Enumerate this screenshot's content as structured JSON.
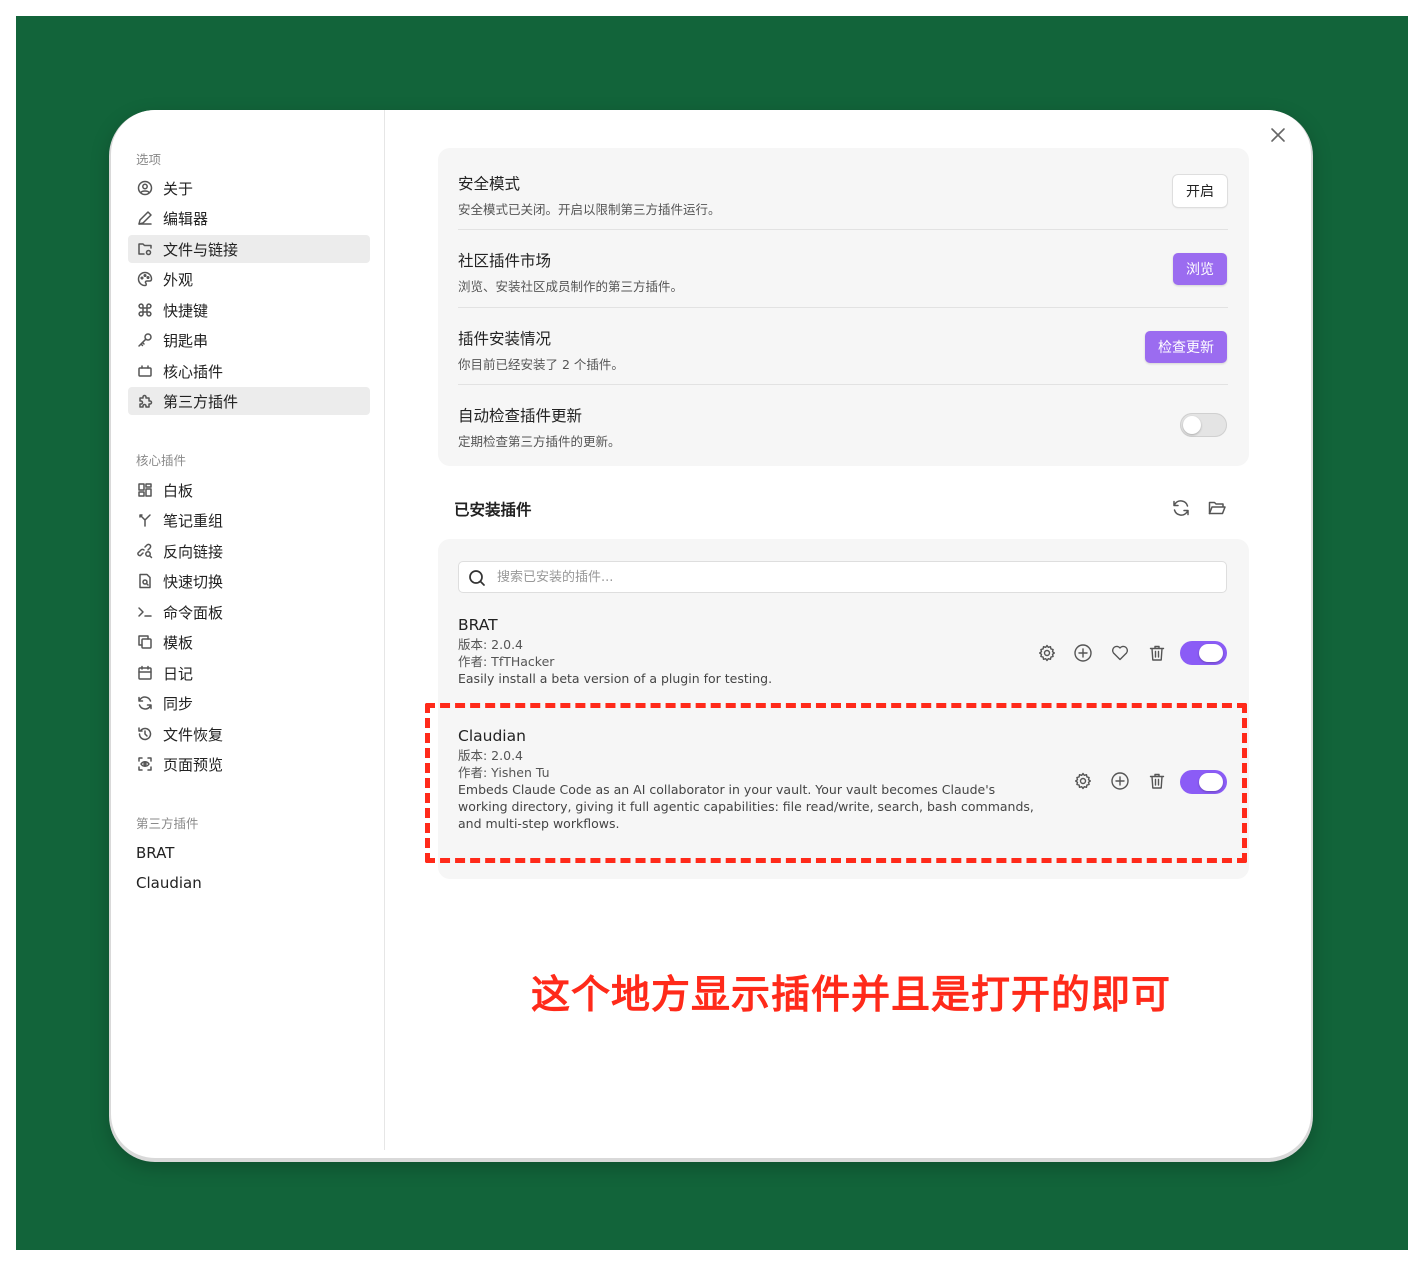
{
  "sidebar": {
    "options_title": "选项",
    "options": [
      {
        "label": "关于",
        "icon": "user-circle-icon"
      },
      {
        "label": "编辑器",
        "icon": "pencil-icon"
      },
      {
        "label": "文件与链接",
        "icon": "folder-cog-icon"
      },
      {
        "label": "外观",
        "icon": "palette-icon"
      },
      {
        "label": "快捷键",
        "icon": "command-icon"
      },
      {
        "label": "钥匙串",
        "icon": "key-icon"
      },
      {
        "label": "核心插件",
        "icon": "plug-icon"
      },
      {
        "label": "第三方插件",
        "icon": "puzzle-icon"
      }
    ],
    "core_title": "核心插件",
    "core": [
      {
        "label": "白板",
        "icon": "layout-dashboard-icon"
      },
      {
        "label": "笔记重组",
        "icon": "merge-icon"
      },
      {
        "label": "反向链接",
        "icon": "link-search-icon"
      },
      {
        "label": "快速切换",
        "icon": "file-search-icon"
      },
      {
        "label": "命令面板",
        "icon": "terminal-icon"
      },
      {
        "label": "模板",
        "icon": "copy-icon"
      },
      {
        "label": "日记",
        "icon": "calendar-icon"
      },
      {
        "label": "同步",
        "icon": "refresh-icon"
      },
      {
        "label": "文件恢复",
        "icon": "history-icon"
      },
      {
        "label": "页面预览",
        "icon": "scan-eye-icon"
      }
    ],
    "third_title": "第三方插件",
    "third": [
      "BRAT",
      "Claudian"
    ]
  },
  "settings": {
    "safe_mode": {
      "title": "安全模式",
      "desc": "安全模式已关闭。开启以限制第三方插件运行。",
      "button": "开启"
    },
    "community": {
      "title": "社区插件市场",
      "desc": "浏览、安装社区成员制作的第三方插件。",
      "button": "浏览"
    },
    "installs": {
      "title": "插件安装情况",
      "desc": "你目前已经安装了 2 个插件。",
      "button": "检查更新"
    },
    "auto_update": {
      "title": "自动检查插件更新",
      "desc": "定期检查第三方插件的更新。",
      "enabled": false
    }
  },
  "installed": {
    "title": "已安装插件",
    "search_placeholder": "搜索已安装的插件...",
    "plugins": [
      {
        "name": "BRAT",
        "version": "版本: 2.0.4",
        "author": "作者: TfTHacker",
        "desc": "Easily install a beta version of a plugin for testing.",
        "enabled": true
      },
      {
        "name": "Claudian",
        "version": "版本: 2.0.4",
        "author": "作者: Yishen Tu",
        "desc": "Embeds Claude Code as an AI collaborator in your vault. Your vault becomes Claude's working directory, giving it full agentic capabilities: file read/write, search, bash commands, and multi-step workflows.",
        "enabled": true
      }
    ]
  },
  "annotation": {
    "text": "这个地方显示插件并且是打开的即可",
    "color": "#ff2a1a"
  },
  "colors": {
    "background": "#12643a",
    "accent": "#9b6cf0"
  }
}
